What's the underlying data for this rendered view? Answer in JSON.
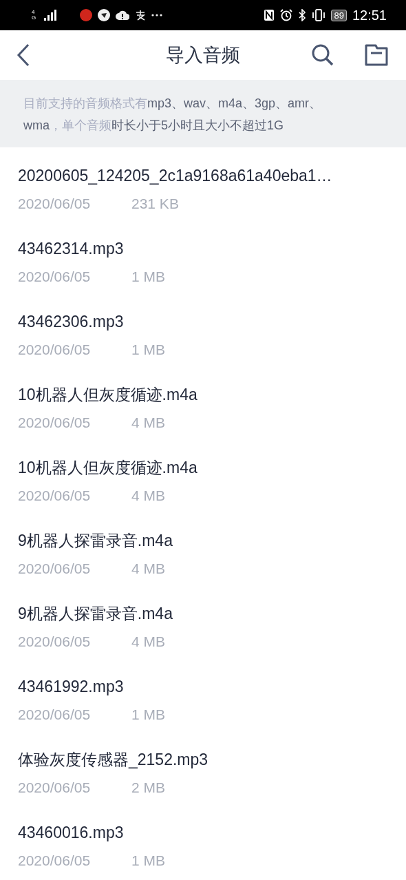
{
  "status_bar": {
    "network": "4G",
    "battery": "89",
    "time": "12:51"
  },
  "header": {
    "title": "导入音频"
  },
  "notice": [
    {
      "text": "目前支持的音频格式有",
      "strong": false
    },
    {
      "text": "mp3、wav、m4a、3gp、amr、wma",
      "strong": true
    },
    {
      "text": "，单个音频",
      "strong": false
    },
    {
      "text": "时长小于5小时且大小不超过1G",
      "strong": true
    }
  ],
  "files": [
    {
      "name": "20200605_124205_2c1a9168a61a40eba1…",
      "date": "2020/06/05",
      "size": "231 KB"
    },
    {
      "name": "43462314.mp3",
      "date": "2020/06/05",
      "size": "1 MB"
    },
    {
      "name": "43462306.mp3",
      "date": "2020/06/05",
      "size": "1 MB"
    },
    {
      "name": "10机器人但灰度循迹.m4a",
      "date": "2020/06/05",
      "size": "4 MB"
    },
    {
      "name": "10机器人但灰度循迹.m4a",
      "date": "2020/06/05",
      "size": "4 MB"
    },
    {
      "name": "9机器人探雷录音.m4a",
      "date": "2020/06/05",
      "size": "4 MB"
    },
    {
      "name": "9机器人探雷录音.m4a",
      "date": "2020/06/05",
      "size": "4 MB"
    },
    {
      "name": "43461992.mp3",
      "date": "2020/06/05",
      "size": "1 MB"
    },
    {
      "name": "体验灰度传感器_2152.mp3",
      "date": "2020/06/05",
      "size": "2 MB"
    },
    {
      "name": "43460016.mp3",
      "date": "2020/06/05",
      "size": "1 MB"
    }
  ]
}
